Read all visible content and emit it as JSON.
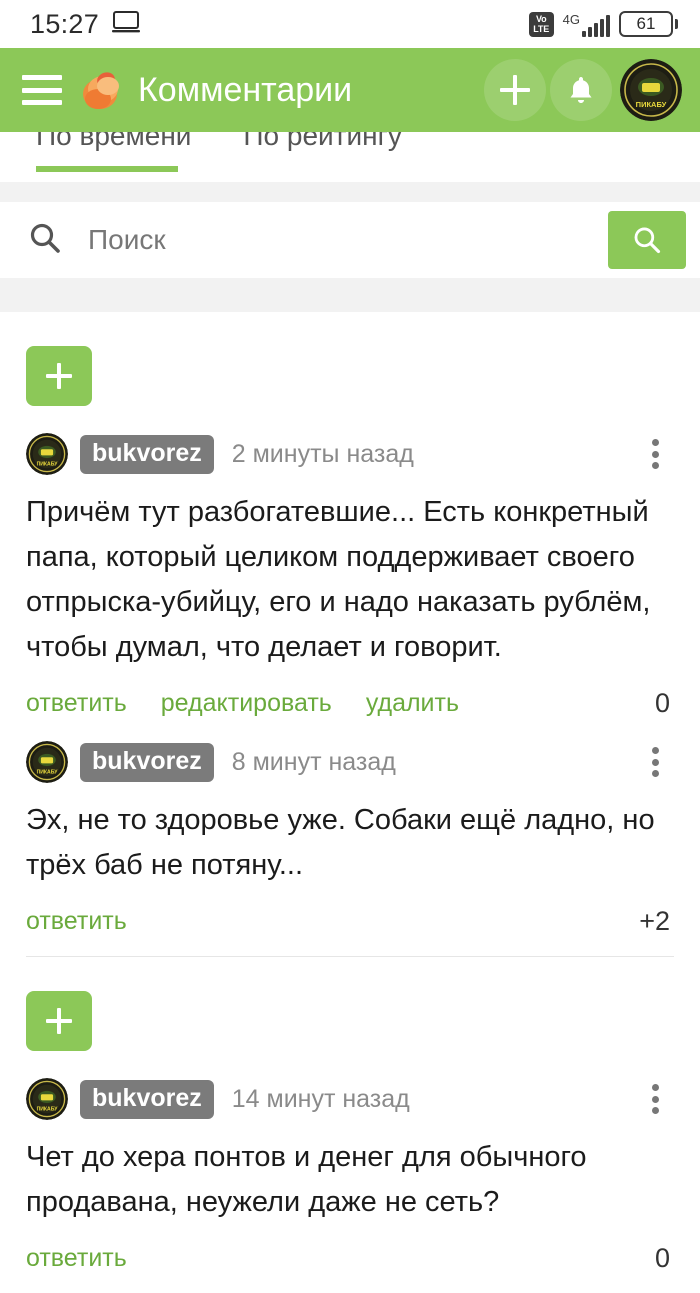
{
  "status_bar": {
    "time": "15:27",
    "cast_icon": "laptop-cast-icon",
    "volte_label_top": "Vo",
    "volte_label_bottom": "LTE",
    "network_type": "4G",
    "battery_level": "61"
  },
  "header": {
    "menu_icon": "hamburger-menu-icon",
    "logo_icon": "pikabu-logo-icon",
    "title": "Комментарии",
    "add_icon": "plus-icon",
    "notifications_icon": "bell-icon",
    "avatar_icon": "user-avatar-icon",
    "background_color": "#8cc858"
  },
  "tabs": [
    {
      "label": "По времени",
      "active": true
    },
    {
      "label": "По рейтингу",
      "active": false
    }
  ],
  "search": {
    "placeholder": "Поиск",
    "value": "",
    "left_icon": "search-icon",
    "button_icon": "search-icon",
    "button_color": "#8cc858"
  },
  "comment_groups": [
    {
      "add_button_label": "+",
      "comments": [
        {
          "username": "bukvorez",
          "timestamp": "2 минуты назад",
          "text": "Причём тут разбогатевшие... Есть конкретный папа, который целиком поддерживает своего отпрыска-убийцу, его и надо наказать рублём, чтобы думал, что делает и говорит.",
          "actions": [
            "ответить",
            "редактировать",
            "удалить"
          ],
          "rating": "0"
        },
        {
          "username": "bukvorez",
          "timestamp": "8 минут назад",
          "text": "Эх, не то здоровье уже. Собаки ещё ладно, но трёх баб не потяну...",
          "actions": [
            "ответить"
          ],
          "rating": "+2"
        }
      ]
    },
    {
      "add_button_label": "+",
      "comments": [
        {
          "username": "bukvorez",
          "timestamp": "14 минут назад",
          "text": "Чет до хера понтов и денег для обычного продавана, неужели даже не сеть?",
          "actions": [
            "ответить"
          ],
          "rating": "0"
        }
      ]
    }
  ]
}
